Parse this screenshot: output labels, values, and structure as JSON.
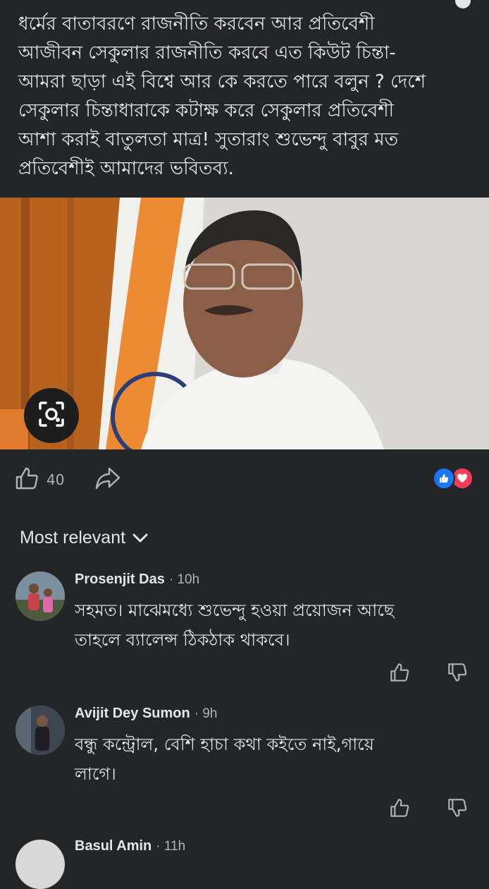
{
  "post": {
    "text": "ধর্মের বাতাবরণে রাজনীতি করবেন আর প্রতিবেশী\nআজীবন সেকুলার রাজনীতি করবে এত কিউট চিন্তা-\nআমরা ছাড়া এই বিশ্বে আর কে করতে পারে বলুন ? দেশে\nসেকুলার চিন্তাধারাকে কটাক্ষ করে  সেকুলার প্রতিবেশী\nআশা করাই বাতুলতা মাত্র! সুতারাং শুভেন্দু বাবুর মত\nপ্রতিবেশীই আমাদের ভবিতব্য.",
    "like_count": "40"
  },
  "comments_sort": {
    "label": "Most relevant"
  },
  "comments": [
    {
      "name": "Prosenjit Das",
      "time": "· 10h",
      "text": "সহমত। মাঝেমধ্যে শুভেন্দু হওয়া প্রয়োজন আছে\nতাহলে ব্যালেন্স ঠিকঠাক থাকবে।"
    },
    {
      "name": "Avijit Dey Sumon",
      "time": "· 9h",
      "text": "বন্ধু কন্ট্রোল, বেশি হাচা কথা কইতে নাই,গায়ে\nলাগে।"
    },
    {
      "name": "Basul Amin",
      "time": "· 11h"
    }
  ],
  "icons": {
    "lens": "visual-search-icon",
    "like": "thumbs-up-icon",
    "share": "share-icon",
    "dislike": "thumbs-down-icon",
    "sort": "chevron-down-icon"
  },
  "colors": {
    "background": "#242526",
    "text": "#e4e6eb",
    "secondary_text": "#b0b3b8",
    "like_reaction": "#1877f2",
    "love_reaction": "#f33e58"
  }
}
